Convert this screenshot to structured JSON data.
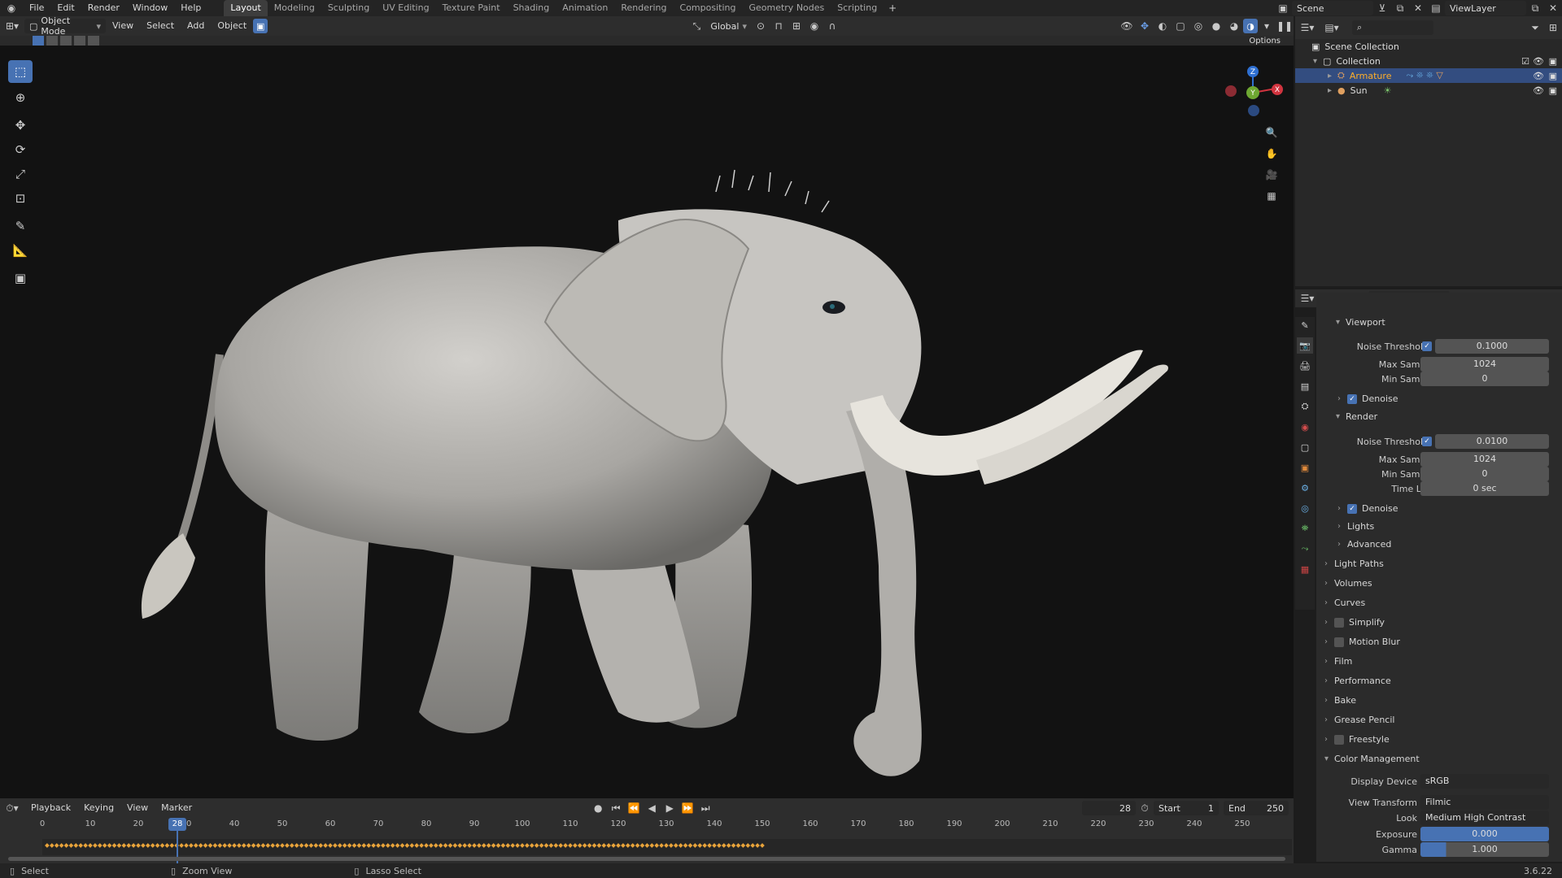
{
  "topbar": {
    "menus": [
      "File",
      "Edit",
      "Render",
      "Window",
      "Help"
    ],
    "workspaces": [
      "Layout",
      "Modeling",
      "Sculpting",
      "UV Editing",
      "Texture Paint",
      "Shading",
      "Animation",
      "Rendering",
      "Compositing",
      "Geometry Nodes",
      "Scripting"
    ],
    "active_workspace": "Layout",
    "scene": "Scene",
    "view_layer": "ViewLayer"
  },
  "viewport_header": {
    "mode": "Object Mode",
    "menus": [
      "View",
      "Select",
      "Add",
      "Object"
    ],
    "orientation": "Global",
    "options": "Options"
  },
  "gizmo": {
    "z": "Z",
    "x": "X",
    "y": "Y"
  },
  "outliner": {
    "root": "Scene Collection",
    "collection": "Collection",
    "items": [
      "Armature",
      "Sun"
    ]
  },
  "properties": {
    "viewport_label": "Viewport",
    "render_label": "Render",
    "noise_threshold_label": "Noise Threshold",
    "max_samples_label": "Max Samples",
    "min_samples_label": "Min Samples",
    "time_limit_label": "Time Limit",
    "denoise_label": "Denoise",
    "lights_label": "Lights",
    "advanced_label": "Advanced",
    "viewport": {
      "noise_threshold": "0.1000",
      "max_samples": "1024",
      "min_samples": "0"
    },
    "render": {
      "noise_threshold": "0.0100",
      "max_samples": "1024",
      "min_samples": "0",
      "time_limit": "0 sec"
    },
    "panels": [
      "Light Paths",
      "Volumes",
      "Curves",
      "Simplify",
      "Motion Blur",
      "Film",
      "Performance",
      "Bake",
      "Grease Pencil",
      "Freestyle"
    ],
    "color_management": {
      "title": "Color Management",
      "display_device_label": "Display Device",
      "display_device": "sRGB",
      "view_transform_label": "View Transform",
      "view_transform": "Filmic",
      "look_label": "Look",
      "look": "Medium High Contrast",
      "exposure_label": "Exposure",
      "exposure": "0.000",
      "gamma_label": "Gamma",
      "gamma": "1.000"
    }
  },
  "timeline": {
    "menus": [
      "Playback",
      "Keying",
      "View",
      "Marker"
    ],
    "current_frame": "28",
    "start_label": "Start",
    "start": "1",
    "end_label": "End",
    "end": "250",
    "ticks": [
      "0",
      "10",
      "20",
      "30",
      "40",
      "50",
      "60",
      "70",
      "80",
      "90",
      "100",
      "110",
      "120",
      "130",
      "140",
      "150",
      "160",
      "170",
      "180",
      "190",
      "200",
      "210",
      "220",
      "230",
      "240",
      "250"
    ]
  },
  "statusbar": {
    "select": "Select",
    "zoom": "Zoom View",
    "lasso": "Lasso Select",
    "version": "3.6.22"
  },
  "colors": {
    "accent": "#4772b3",
    "keyframe": "#e8a33a"
  }
}
